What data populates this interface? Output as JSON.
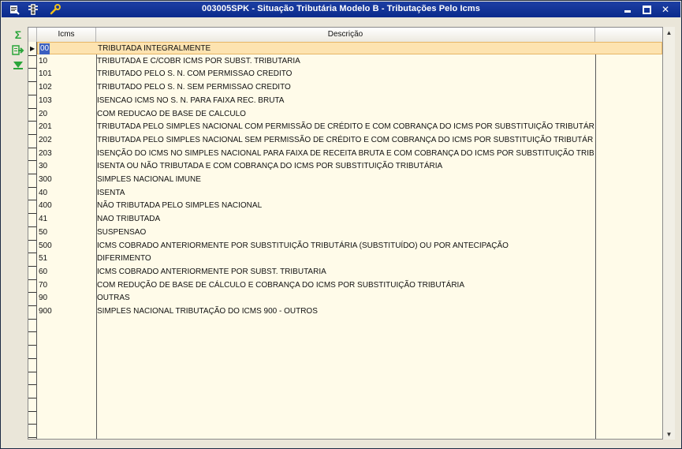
{
  "window": {
    "title": "003005SPK - Situação Tributária Modelo B - Tributações Pelo Icms",
    "minimize": "▬",
    "maximize": "□",
    "close": "✕"
  },
  "toolbar": {
    "icons": [
      "window-menu-icon",
      "traffic-light-icon",
      "wrench-icon"
    ]
  },
  "sidetools": {
    "sum": "Σ",
    "export": "⇨",
    "expand": "▼"
  },
  "grid": {
    "headers": {
      "icms": "Icms",
      "descricao": "Descrição"
    },
    "rows": [
      {
        "icms": "00",
        "descricao": "TRIBUTADA INTEGRALMENTE"
      },
      {
        "icms": "10",
        "descricao": "TRIBUTADA E C/COBR ICMS POR SUBST. TRIBUTARIA"
      },
      {
        "icms": "101",
        "descricao": "TRIBUTADO PELO S. N. COM PERMISSAO CREDITO"
      },
      {
        "icms": "102",
        "descricao": "TRIBUTADO PELO S. N. SEM PERMISSAO CREDITO"
      },
      {
        "icms": "103",
        "descricao": "ISENCAO ICMS NO S. N. PARA FAIXA REC. BRUTA"
      },
      {
        "icms": "20",
        "descricao": "COM REDUCAO DE BASE DE CALCULO"
      },
      {
        "icms": "201",
        "descricao": "TRIBUTADA PELO SIMPLES NACIONAL COM PERMISSÃO DE CRÉDITO E COM COBRANÇA DO ICMS POR SUBSTITUIÇÃO TRIBUTÁRIA"
      },
      {
        "icms": "202",
        "descricao": "TRIBUTADA PELO SIMPLES NACIONAL SEM PERMISSÃO DE CRÉDITO E COM COBRANÇA DO ICMS POR SUBSTITUIÇÃO TRIBUTÁRIA"
      },
      {
        "icms": "203",
        "descricao": "ISENÇÃO DO ICMS NO SIMPLES NACIONAL PARA FAIXA DE RECEITA BRUTA E COM COBRANÇA DO ICMS POR SUBSTITUIÇÃO TRIBUTÁRIA"
      },
      {
        "icms": "30",
        "descricao": "ISENTA OU NÃO TRIBUTADA E COM COBRANÇA DO ICMS POR SUBSTITUIÇÃO TRIBUTÁRIA"
      },
      {
        "icms": "300",
        "descricao": "SIMPLES NACIONAL IMUNE"
      },
      {
        "icms": "40",
        "descricao": "ISENTA"
      },
      {
        "icms": "400",
        "descricao": "NÃO TRIBUTADA PELO SIMPLES NACIONAL"
      },
      {
        "icms": "41",
        "descricao": "NAO TRIBUTADA"
      },
      {
        "icms": "50",
        "descricao": "SUSPENSAO"
      },
      {
        "icms": "500",
        "descricao": "ICMS COBRADO ANTERIORMENTE POR SUBSTITUIÇÃO TRIBUTÁRIA (SUBSTITUÍDO) OU POR ANTECIPAÇÃO"
      },
      {
        "icms": "51",
        "descricao": "DIFERIMENTO"
      },
      {
        "icms": "60",
        "descricao": "ICMS COBRADO ANTERIORMENTE POR SUBST. TRIBUTARIA"
      },
      {
        "icms": "70",
        "descricao": "COM REDUÇÃO DE BASE DE CÁLCULO E COBRANÇA DO ICMS POR SUBSTITUIÇÃO TRIBUTÁRIA"
      },
      {
        "icms": "90",
        "descricao": "OUTRAS"
      },
      {
        "icms": "900",
        "descricao": "SIMPLES NACIONAL TRIBUTAÇÃO DO ICMS 900 - OUTROS"
      }
    ],
    "selected_index": 0
  },
  "scrollbar": {
    "up": "▲",
    "down": "▼"
  },
  "colors": {
    "titlebar": "#0a2a8c",
    "grid_bg": "#fffbe9",
    "selected_row": "#fde3b0",
    "accent_green": "#2aa53a"
  }
}
